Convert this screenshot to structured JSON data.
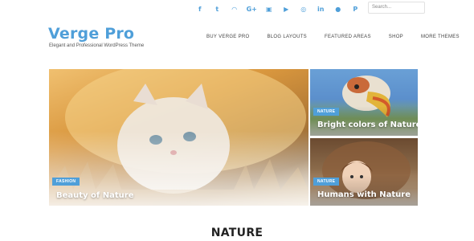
{
  "social": {
    "icons": [
      {
        "name": "facebook-icon",
        "glyph": "f"
      },
      {
        "name": "twitter-icon",
        "glyph": "t"
      },
      {
        "name": "rss-icon",
        "glyph": "◠"
      },
      {
        "name": "google-plus-icon",
        "glyph": "G+"
      },
      {
        "name": "flickr-icon",
        "glyph": "▣"
      },
      {
        "name": "youtube-icon",
        "glyph": "▶"
      },
      {
        "name": "dribbble-icon",
        "glyph": "◎"
      },
      {
        "name": "linkedin-icon",
        "glyph": "in"
      },
      {
        "name": "reddit-icon",
        "glyph": "●"
      },
      {
        "name": "pinterest-icon",
        "glyph": "P"
      }
    ],
    "accent_color": "#4f9fd9"
  },
  "search": {
    "placeholder": "Search..."
  },
  "header": {
    "title": "Verge Pro",
    "tagline": "Elegant and Professional WordPress Theme"
  },
  "nav": {
    "items": [
      "BUY VERGE PRO",
      "BLOG LAYOUTS",
      "FEATURED AREAS",
      "SHOP",
      "MORE THEMES"
    ]
  },
  "featured": {
    "main": {
      "category": "FASHION",
      "title": "Beauty of Nature"
    },
    "side": [
      {
        "category": "NATURE",
        "title": "Bright colors of Nature"
      },
      {
        "category": "NATURE",
        "title": "Humans with Nature"
      }
    ]
  },
  "section": {
    "title": "NATURE"
  }
}
